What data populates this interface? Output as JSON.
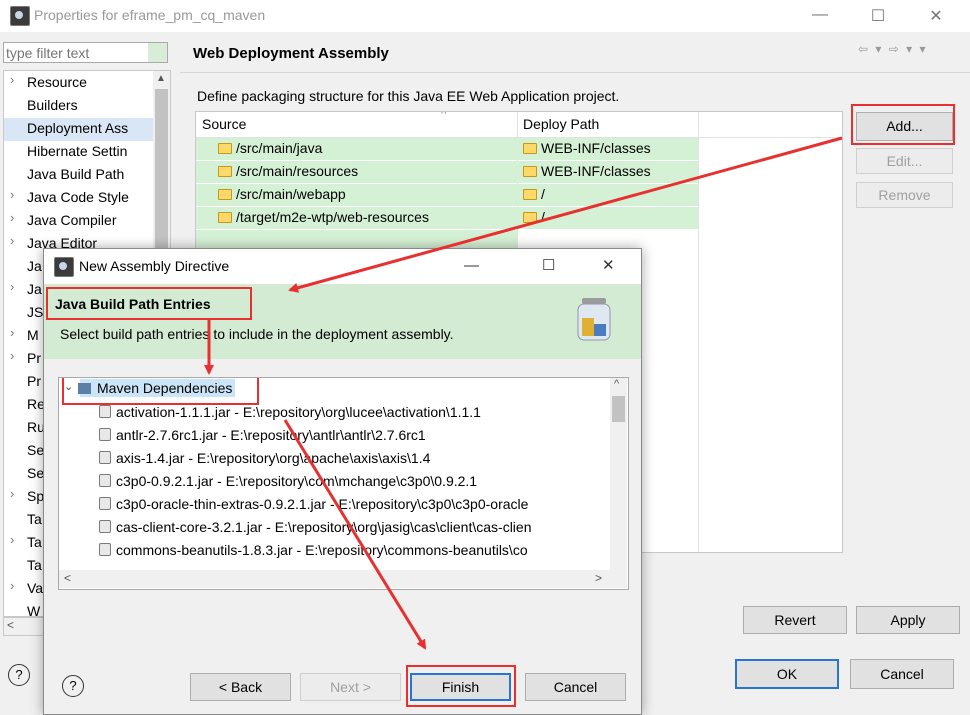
{
  "outer_window": {
    "title": "Properties for eframe_pm_cq_maven",
    "controls": {
      "minimize": "—",
      "maximize": "☐",
      "close": "✕"
    }
  },
  "filter": {
    "placeholder": "type filter text"
  },
  "nav": {
    "items": [
      {
        "label": "Resource",
        "expandable": true
      },
      {
        "label": "Builders",
        "expandable": false
      },
      {
        "label": "Deployment Ass",
        "expandable": false,
        "selected": true
      },
      {
        "label": "Hibernate Settin",
        "expandable": false
      },
      {
        "label": "Java Build Path",
        "expandable": false
      },
      {
        "label": "Java Code Style",
        "expandable": true
      },
      {
        "label": "Java Compiler",
        "expandable": true
      },
      {
        "label": "Java Editor",
        "expandable": true
      },
      {
        "label": "Ja",
        "expandable": false
      },
      {
        "label": "Ja",
        "expandable": true
      },
      {
        "label": "JS",
        "expandable": false
      },
      {
        "label": "M",
        "expandable": true
      },
      {
        "label": "Pr",
        "expandable": true
      },
      {
        "label": "Pr",
        "expandable": false
      },
      {
        "label": "Re",
        "expandable": false
      },
      {
        "label": "Ru",
        "expandable": false
      },
      {
        "label": "Se",
        "expandable": false
      },
      {
        "label": "Se",
        "expandable": false
      },
      {
        "label": "Sp",
        "expandable": true
      },
      {
        "label": "Ta",
        "expandable": false
      },
      {
        "label": "Ta",
        "expandable": true
      },
      {
        "label": "Ta",
        "expandable": false
      },
      {
        "label": "Va",
        "expandable": true
      },
      {
        "label": "W",
        "expandable": false
      }
    ]
  },
  "page": {
    "title": "Web Deployment Assembly",
    "description": "Define packaging structure for this Java EE Web Application project.",
    "nav_arrows": "⇦ ▾ ⇨ ▾ ▾",
    "table": {
      "columns": [
        "Source",
        "Deploy Path"
      ],
      "rows": [
        {
          "source": "/src/main/java",
          "deploy": "WEB-INF/classes"
        },
        {
          "source": "/src/main/resources",
          "deploy": "WEB-INF/classes"
        },
        {
          "source": "/src/main/webapp",
          "deploy": "/"
        },
        {
          "source": "/target/m2e-wtp/web-resources",
          "deploy": "/"
        }
      ]
    },
    "buttons": {
      "add": "Add...",
      "edit": "Edit...",
      "remove": "Remove",
      "revert": "Revert",
      "apply": "Apply",
      "ok": "OK",
      "cancel": "Cancel"
    }
  },
  "dialog": {
    "title": "New Assembly Directive",
    "heading": "Java Build Path Entries",
    "description": "Select build path entries to include in the deployment assembly.",
    "tree_root": "Maven Dependencies",
    "tree_items": [
      "activation-1.1.1.jar - E:\\repository\\org\\lucee\\activation\\1.1.1",
      "antlr-2.7.6rc1.jar - E:\\repository\\antlr\\antlr\\2.7.6rc1",
      "axis-1.4.jar - E:\\repository\\org\\apache\\axis\\axis\\1.4",
      "c3p0-0.9.2.1.jar - E:\\repository\\com\\mchange\\c3p0\\0.9.2.1",
      "c3p0-oracle-thin-extras-0.9.2.1.jar - E:\\repository\\c3p0\\c3p0-oracle",
      "cas-client-core-3.2.1.jar - E:\\repository\\org\\jasig\\cas\\client\\cas-clien",
      "commons-beanutils-1.8.3.jar - E:\\repository\\commons-beanutils\\co"
    ],
    "buttons": {
      "back": "< Back",
      "next": "Next >",
      "finish": "Finish",
      "cancel": "Cancel"
    },
    "controls": {
      "minimize": "—",
      "maximize": "☐",
      "close": "✕"
    }
  },
  "colors": {
    "annotation": "#e83030",
    "highlight_row": "#d5f1d5",
    "banner": "#d3ead3",
    "selection": "#d9e6f5"
  }
}
